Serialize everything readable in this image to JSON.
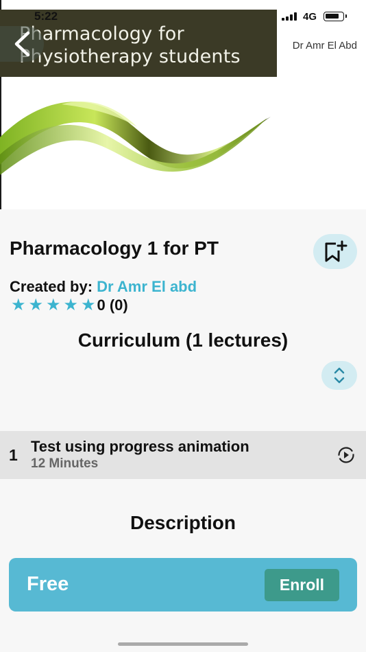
{
  "status_bar": {
    "time": "5:22",
    "network": "4G"
  },
  "hero": {
    "title_line1": "Pharmacology for",
    "title_line2": "Physiotherapy students",
    "author": "Dr Amr El Abd"
  },
  "course": {
    "title": "Pharmacology 1 for PT",
    "created_label": "Created by:",
    "created_name": "Dr Amr El abd",
    "rating_text": "0 (0)",
    "star_count": 5
  },
  "curriculum": {
    "heading": "Curriculum (1 lectures)",
    "lectures": [
      {
        "index": "1",
        "title": "Test using progress animation",
        "duration": "12 Minutes"
      }
    ]
  },
  "description_heading": "Description",
  "enroll": {
    "price": "Free",
    "button_label": "Enroll"
  },
  "colors": {
    "accent": "#3cb4cf",
    "enroll_bar": "#57b9d3",
    "enroll_button": "#3d9a8b",
    "pill_bg": "#d3ecf2"
  }
}
